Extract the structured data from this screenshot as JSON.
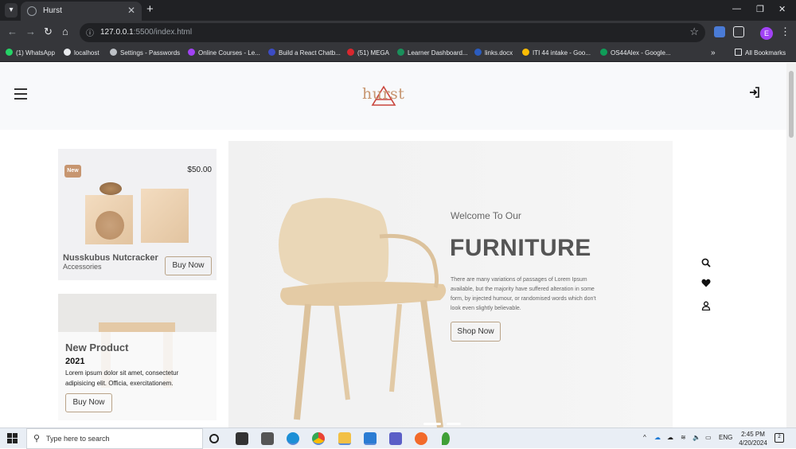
{
  "browser": {
    "tab_title": "Hurst",
    "url_host": "127.0.0.1",
    "url_rest": ":5500/index.html",
    "profile_initial": "E",
    "bookmarks": [
      "(1) WhatsApp",
      "localhost",
      "Settings - Passwords",
      "Online Courses - Le...",
      "Build a React Chatb...",
      "(51) MEGA",
      "Learner Dashboard...",
      "links.docx",
      "ITI 44 intake - Goo...",
      "OS44Alex - Google..."
    ],
    "all_bookmarks": "All Bookmarks"
  },
  "site": {
    "logo": "hurst",
    "card1": {
      "badge": "New",
      "price": "$50.00",
      "name": "Nusskubus Nutcracker",
      "category": "Accessories",
      "button": "Buy Now"
    },
    "card2": {
      "title": "New Product",
      "year": "2021",
      "description": "Lorem ipsum dolor sit amet, consectetur adipisicing elit. Officia, exercitationem.",
      "button": "Buy Now"
    },
    "hero": {
      "welcome": "Welcome To Our",
      "title": "FURNITURE",
      "description": "There are many variations of passages of Lorem Ipsum available, but the majority have suffered alteration in some form, by injected humour, or randomised words which don't look even slightly believable.",
      "button": "Shop Now"
    }
  },
  "taskbar": {
    "search_placeholder": "Type here to search",
    "language": "ENG",
    "time": "2:45 PM",
    "date": "4/20/2024",
    "notification_count": "2"
  },
  "colors": {
    "accent": "#c79670",
    "chrome_dark": "#202124",
    "chrome_mid": "#35363a"
  }
}
